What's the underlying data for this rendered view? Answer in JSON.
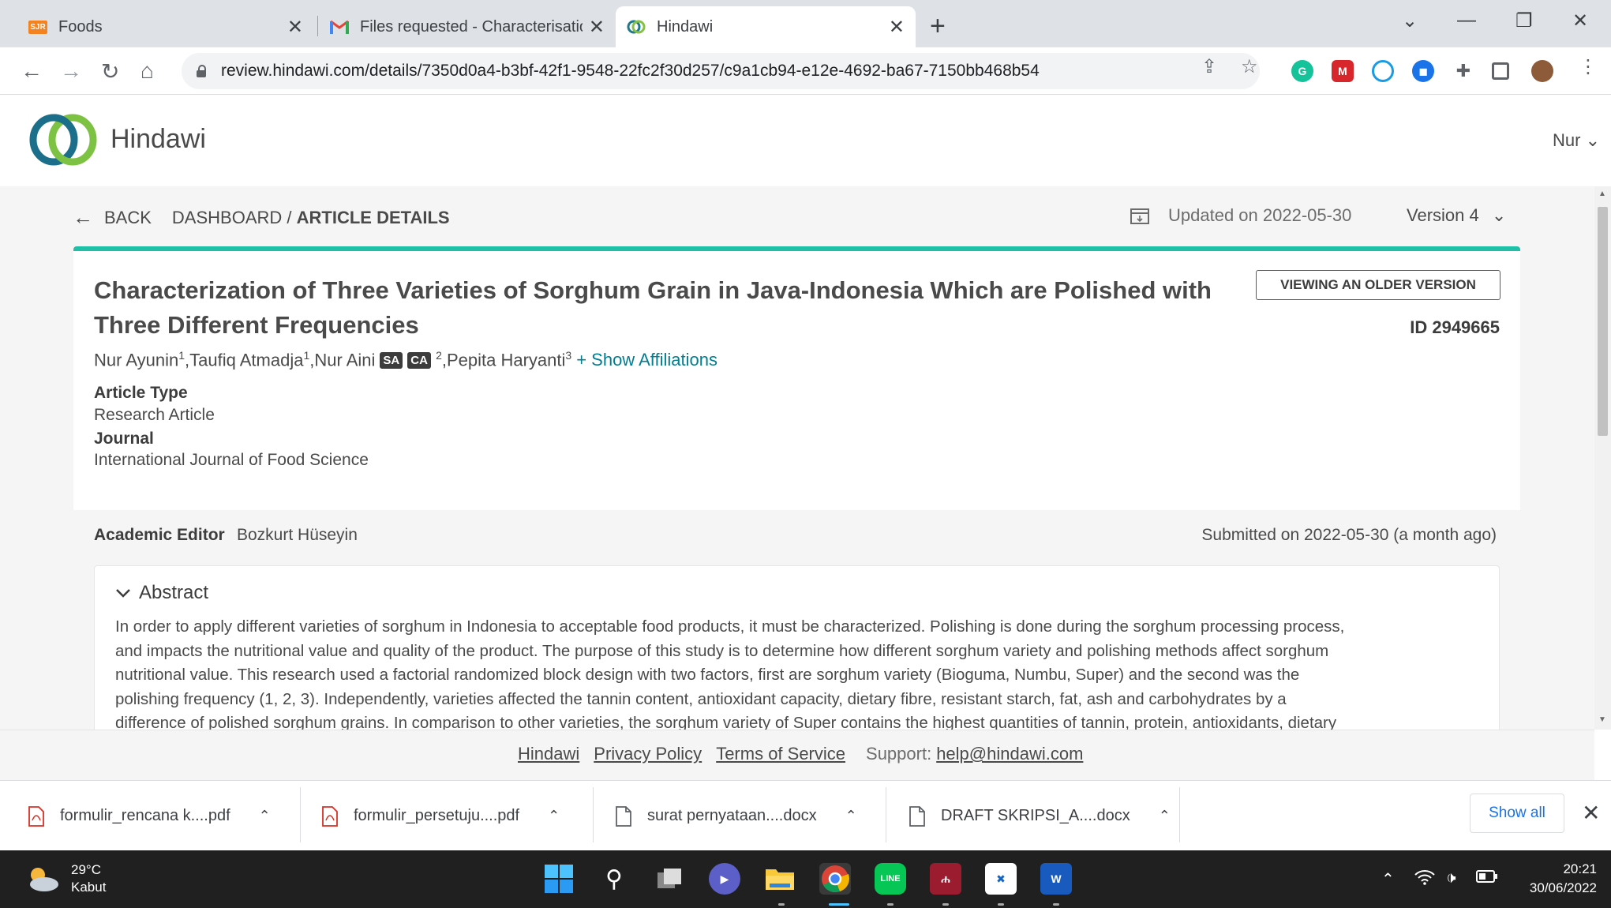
{
  "browser": {
    "tabs": [
      {
        "favicon": "sjr-favicon",
        "badge": "SJR",
        "title": "Foods"
      },
      {
        "favicon": "gmail-icon",
        "title": "Files requested - Characterisation"
      },
      {
        "favicon": "hindawi-favicon",
        "title": "Hindawi"
      }
    ],
    "url": "review.hindawi.com/details/7350d0a4-b3bf-42f1-9548-22fc2f30d257/c9a1cb94-e12e-4692-ba67-7150bb468b54"
  },
  "site": {
    "brand": "Hindawi",
    "user": "Nur"
  },
  "breadcrumb": {
    "back": "BACK",
    "dashboard": "DASHBOARD /",
    "current": "ARTICLE DETAILS",
    "updated": "Updated on 2022-05-30",
    "version": "Version 4"
  },
  "article": {
    "title": "Characterization of Three Varieties of Sorghum Grain in Java-Indonesia Which are Polished with Three Different Frequencies",
    "older_version_button": "VIEWING AN OLDER VERSION",
    "id": "ID 2949665",
    "authors": [
      {
        "name": "Nur Ayunin",
        "sup": "1",
        "sep": ", "
      },
      {
        "name": "Taufiq Atmadja",
        "sup": "1",
        "sep": ", "
      },
      {
        "name": "Nur Aini",
        "sup": "2",
        "sep": ", "
      },
      {
        "name": "Pepita Haryanti",
        "sup": "3",
        "sep": ""
      }
    ],
    "badges": [
      "SA",
      "CA"
    ],
    "show_affiliations": "+ Show Affiliations",
    "type_label": "Article Type",
    "type_value": "Research Article",
    "journal_label": "Journal",
    "journal_value": "International Journal of Food Science",
    "editor_label": "Academic Editor",
    "editor_value": "Bozkurt Hüseyin",
    "submitted": "Submitted on 2022-05-30 (a month ago)",
    "abstract_label": "Abstract",
    "abstract_lines": [
      "In order to apply different varieties of sorghum in Indonesia to acceptable food products, it must be characterized. Polishing is done during the sorghum processing process,",
      "and impacts the nutritional value and quality of the product. The purpose of this study is to determine how different sorghum variety and polishing methods affect sorghum",
      "nutritional value. This research used a factorial randomized block design with two factors, first are sorghum variety (Bioguma, Numbu, Super) and the second was the",
      "polishing frequency (1, 2, 3).  Independently, varieties affected the tannin content, antioxidant capacity, dietary fibre, resistant starch, fat, ash and carbohydrates by a",
      "difference of polished sorghum grains. In comparison to other varieties, the sorghum variety of Super contains the highest quantities of tannin, protein, antioxidants, dietary"
    ]
  },
  "footer": {
    "links": [
      "Hindawi",
      "Privacy Policy",
      "Terms of Service"
    ],
    "support_label": "Support:",
    "support_email": "help@hindawi.com"
  },
  "downloads": {
    "items": [
      {
        "name": "formulir_rencana k....pdf",
        "kind": "pdf"
      },
      {
        "name": "formulir_persetuju....pdf",
        "kind": "pdf"
      },
      {
        "name": "surat pernyataan....docx",
        "kind": "doc"
      },
      {
        "name": "DRAFT SKRIPSI_A....docx",
        "kind": "doc"
      }
    ],
    "show_all": "Show all"
  },
  "taskbar": {
    "temperature": "29°C",
    "weather": "Kabut",
    "time": "20:21",
    "date": "30/06/2022"
  },
  "colors": {
    "accent": "#1fc0a8",
    "link": "#007e92",
    "chrome_blue": "#1a73e8"
  }
}
